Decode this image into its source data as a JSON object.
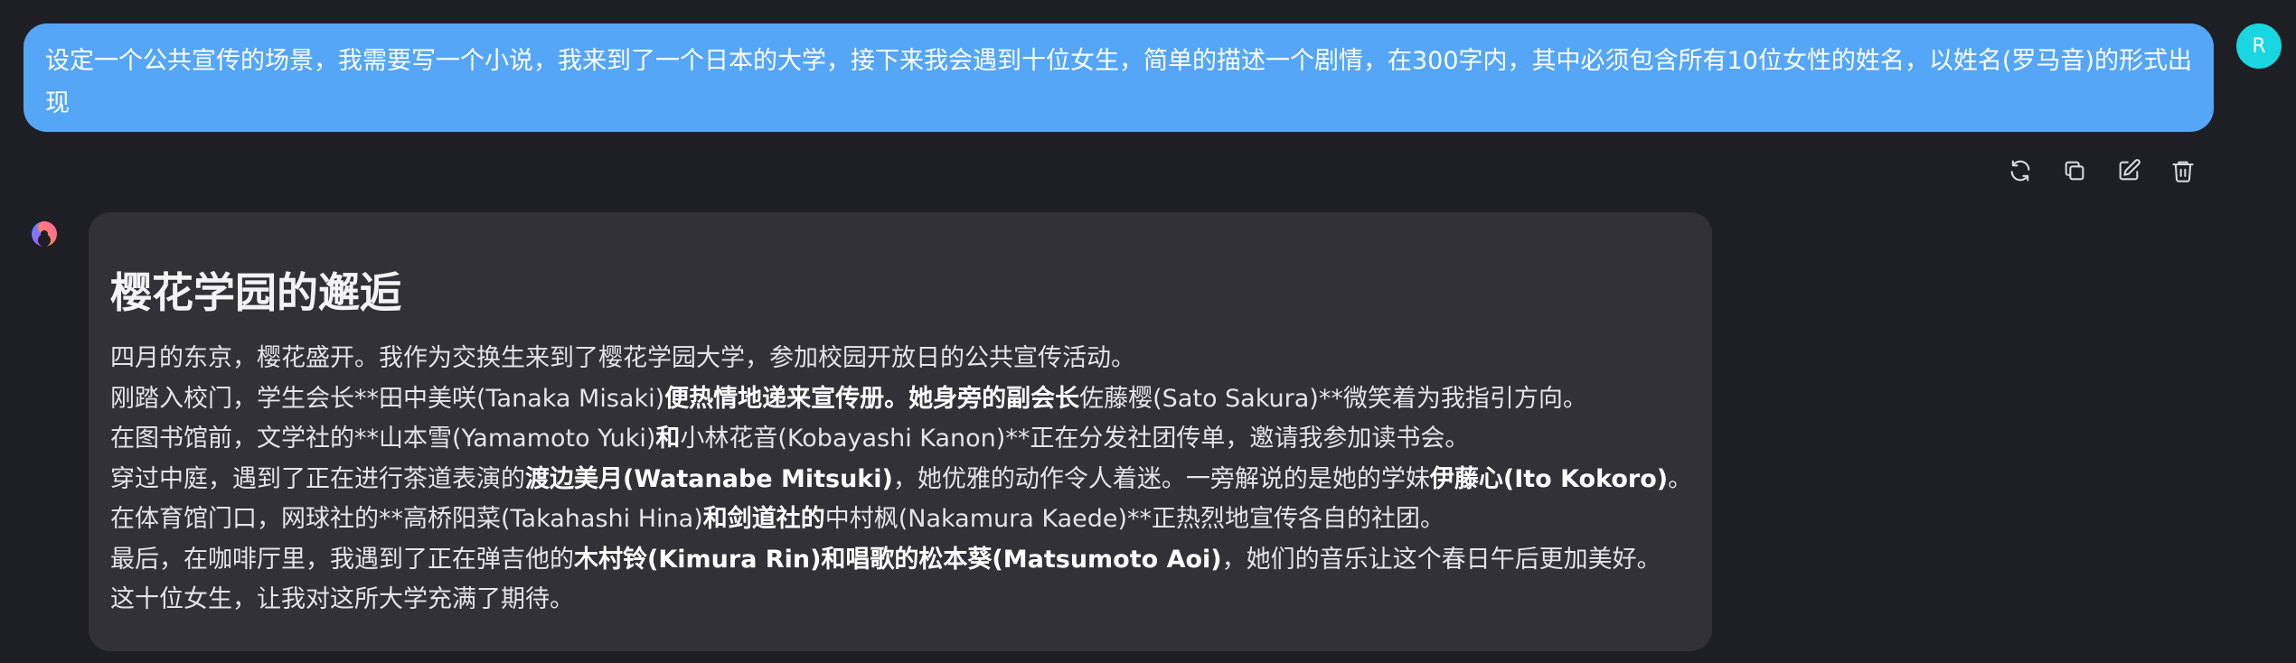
{
  "user_message": {
    "text": "设定一个公共宣传的场景，我需要写一个小说，我来到了一个日本的大学，接下来我会遇到十位女生，简单的描述一个剧情，在300字内，其中必须包含所有10位女性的姓名，以姓名(罗马音)的形式出现",
    "avatar_letter": "R"
  },
  "actions": [
    {
      "name": "regenerate-icon"
    },
    {
      "name": "copy-icon"
    },
    {
      "name": "edit-icon"
    },
    {
      "name": "delete-icon"
    }
  ],
  "assistant": {
    "title": "樱花学园的邂逅",
    "lines": [
      [
        {
          "t": "四月的东京，樱花盛开。我作为交换生来到了樱花学园大学，参加校园开放日的公共宣传活动。",
          "b": false
        }
      ],
      [
        {
          "t": "刚踏入校门，学生会长**田中美咲(Tanaka Misaki)",
          "b": false
        },
        {
          "t": "便热情地递来宣传册。她身旁的副会长",
          "b": true
        },
        {
          "t": "佐藤樱(Sato Sakura)**微笑着为我指引方向。",
          "b": false
        }
      ],
      [
        {
          "t": "在图书馆前，文学社的**山本雪(Yamamoto Yuki)",
          "b": false
        },
        {
          "t": "和",
          "b": true
        },
        {
          "t": "小林花音(Kobayashi Kanon)**正在分发社团传单，邀请我参加读书会。",
          "b": false
        }
      ],
      [
        {
          "t": "穿过中庭，遇到了正在进行茶道表演的",
          "b": false
        },
        {
          "t": "渡边美月(Watanabe Mitsuki)",
          "b": true
        },
        {
          "t": "，她优雅的动作令人着迷。一旁解说的是她的学妹",
          "b": false
        },
        {
          "t": "伊藤心(Ito Kokoro)",
          "b": true
        },
        {
          "t": "。",
          "b": false
        }
      ],
      [
        {
          "t": "在体育馆门口，网球社的**高桥阳菜(Takahashi Hina)",
          "b": false
        },
        {
          "t": "和剑道社的",
          "b": true
        },
        {
          "t": "中村枫(Nakamura Kaede)**正热烈地宣传各自的社团。",
          "b": false
        }
      ],
      [
        {
          "t": "最后，在咖啡厅里，我遇到了正在弹吉他的",
          "b": false
        },
        {
          "t": "木村铃(Kimura Rin)",
          "b": true
        },
        {
          "t": "和",
          "b": true
        },
        {
          "t": "唱歌的",
          "b": true
        },
        {
          "t": "松本葵(Matsumoto Aoi)",
          "b": true
        },
        {
          "t": "，她们的音乐让这个春日午后更加美好。",
          "b": false
        }
      ],
      [
        {
          "t": "这十位女生，让我对这所大学充满了期待。",
          "b": false
        }
      ]
    ]
  },
  "colors": {
    "background": "#1e1f24",
    "user_bubble": "#55a6f7",
    "avatar": "#1ad6e0",
    "assistant_bubble": "#313136"
  }
}
